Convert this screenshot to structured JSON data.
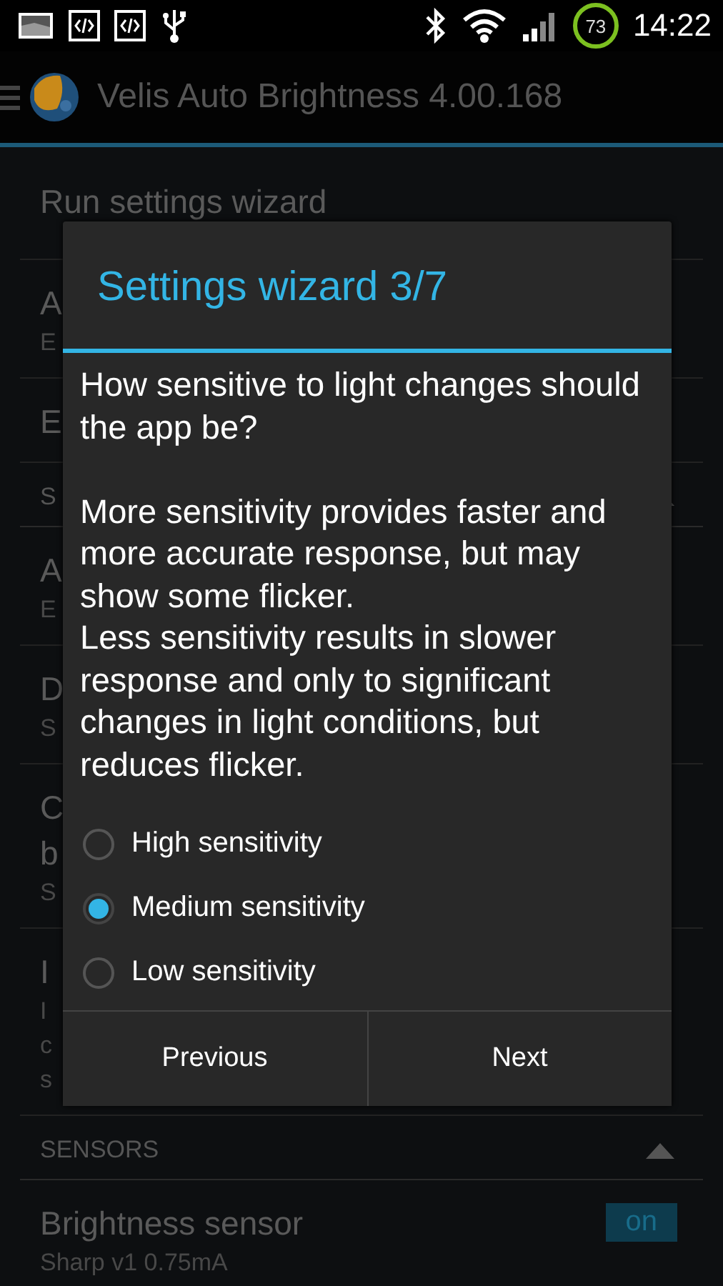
{
  "status_bar": {
    "battery": "73",
    "time": "14:22"
  },
  "action_bar": {
    "title": "Velis Auto Brightness 4.00.168"
  },
  "background_sections": [
    {
      "rows": [
        {
          "lines": [
            {
              "text": "Run settings wizard",
              "kind": "title"
            }
          ]
        },
        {
          "lines": [
            {
              "text": "A",
              "kind": "title"
            },
            {
              "text": "E",
              "kind": "sub"
            }
          ]
        },
        {
          "lines": [
            {
              "text": "E",
              "kind": "title"
            }
          ]
        }
      ]
    },
    {
      "header": "S",
      "rows": [
        {
          "lines": [
            {
              "text": "A",
              "kind": "title"
            },
            {
              "text": "E",
              "kind": "sub"
            }
          ]
        },
        {
          "lines": [
            {
              "text": "D",
              "kind": "title"
            },
            {
              "text": "S",
              "kind": "sub"
            }
          ]
        },
        {
          "lines": [
            {
              "text": "C",
              "kind": "title"
            },
            {
              "text": "b",
              "kind": "title"
            },
            {
              "text": "S",
              "kind": "sub"
            }
          ]
        },
        {
          "lines": [
            {
              "text": "I",
              "kind": "title"
            },
            {
              "text": "I",
              "kind": "sub"
            },
            {
              "text": "c",
              "kind": "sub"
            },
            {
              "text": "s",
              "kind": "sub"
            }
          ]
        }
      ]
    },
    {
      "header": "SENSORS",
      "rows": [
        {
          "lines": [
            {
              "text": "Brightness sensor",
              "kind": "title"
            },
            {
              "text": "Sharp v1 0.75mA",
              "kind": "sub"
            }
          ],
          "toggle": {
            "label": "on",
            "on": true
          }
        }
      ]
    }
  ],
  "dialog": {
    "title": "Settings wizard 3/7",
    "message": "How sensitive to light changes should the app be?\n\nMore sensitivity provides faster and more accurate response, but may show some flicker.\nLess sensitivity results in slower response and only to significant changes in light conditions, but reduces flicker.",
    "options": [
      {
        "label": "High sensitivity",
        "selected": false
      },
      {
        "label": "Medium sensitivity",
        "selected": true
      },
      {
        "label": "Low sensitivity",
        "selected": false
      }
    ],
    "buttons": [
      "Previous",
      "Next"
    ]
  }
}
